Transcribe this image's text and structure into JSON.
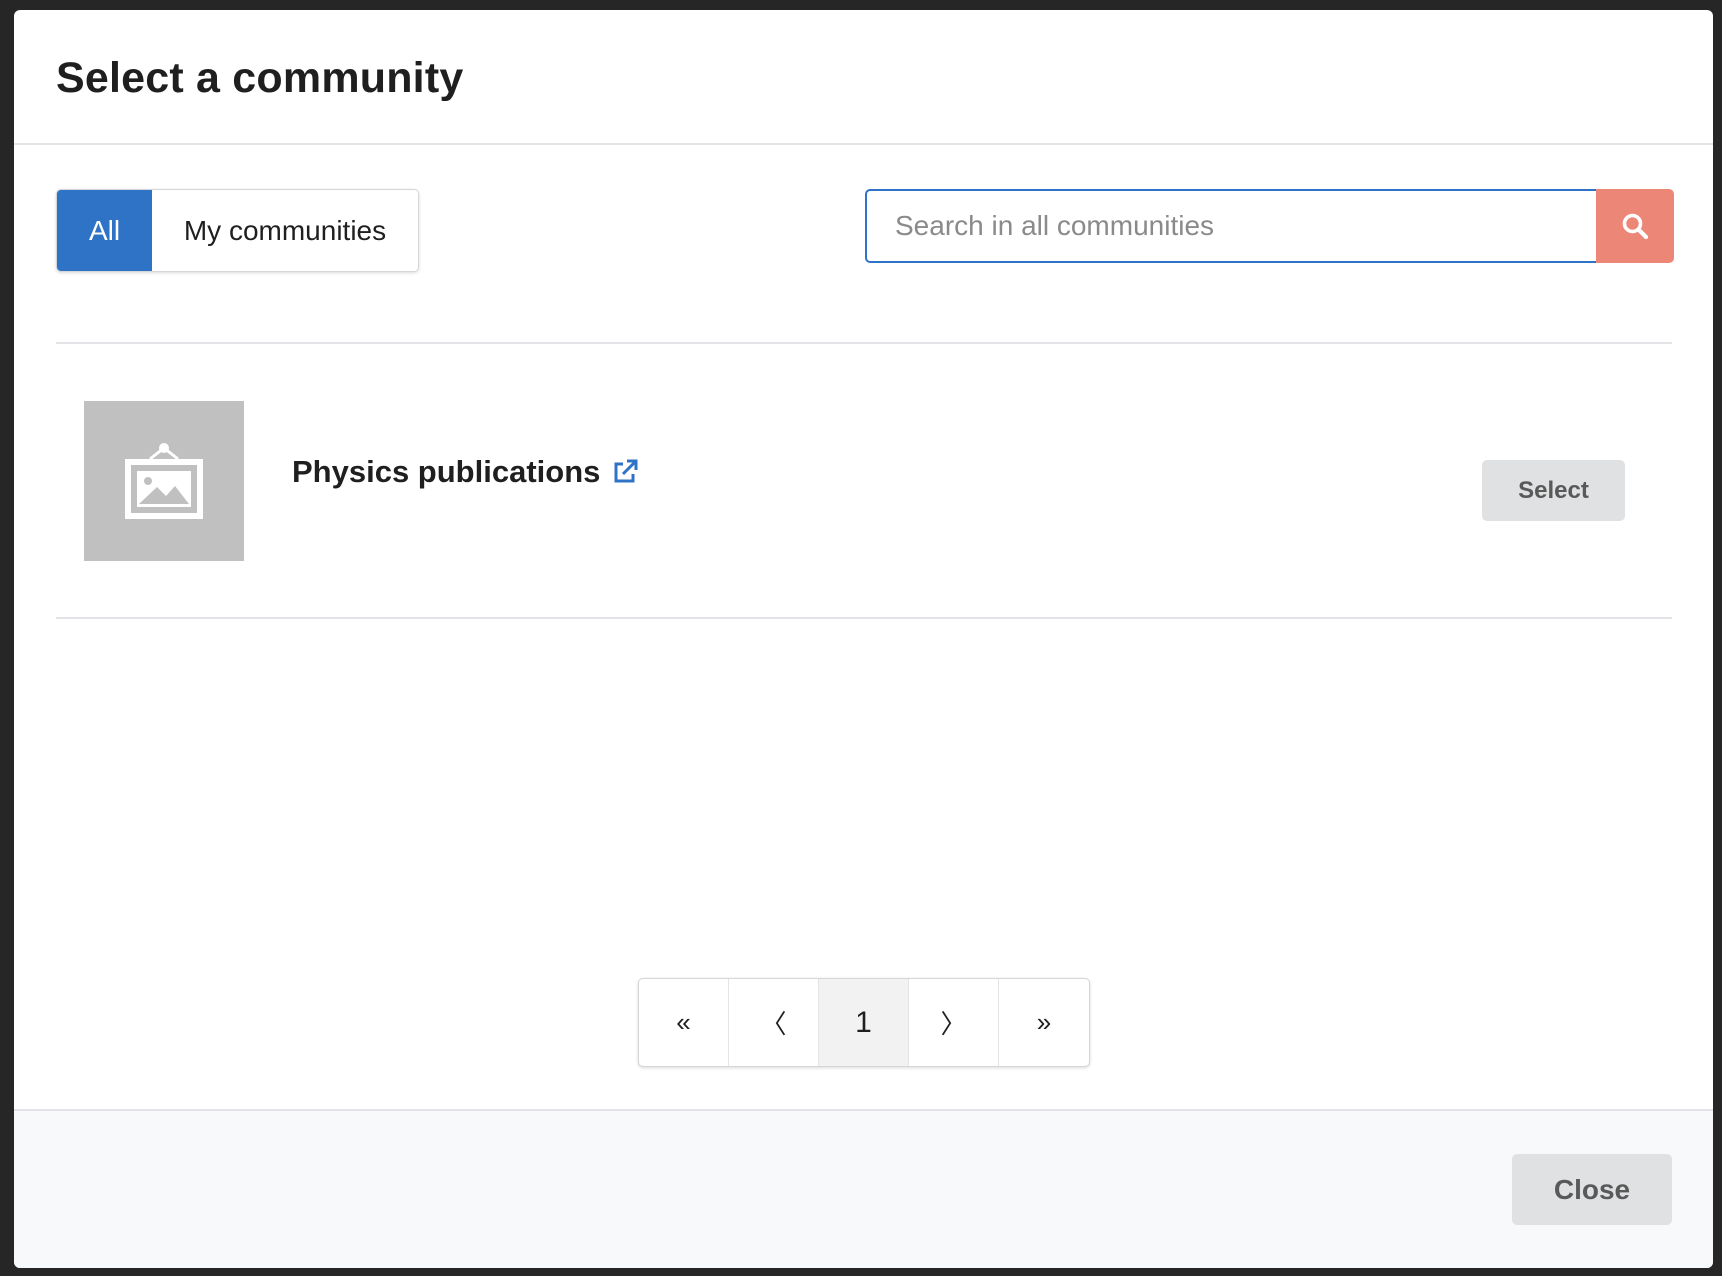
{
  "modal": {
    "title": "Select a community"
  },
  "filters": {
    "all_label": "All",
    "my_communities_label": "My communities",
    "active": "All"
  },
  "search": {
    "placeholder": "Search in all communities",
    "value": "",
    "icon": "search-icon"
  },
  "communities": [
    {
      "name": "Physics publications",
      "thumbnail_icon": "image-placeholder-icon",
      "link_icon": "external-link-icon",
      "select_label": "Select"
    }
  ],
  "pagination": {
    "first_label": "«",
    "prev_label": "〈",
    "current_page": "1",
    "next_label": "〉",
    "last_label": "»"
  },
  "footer": {
    "close_label": "Close"
  },
  "colors": {
    "primary": "#2f73c6",
    "search_button": "#ec8676",
    "neutral_button": "#e0e1e2",
    "thumbnail_bg": "#c0c0c1"
  }
}
